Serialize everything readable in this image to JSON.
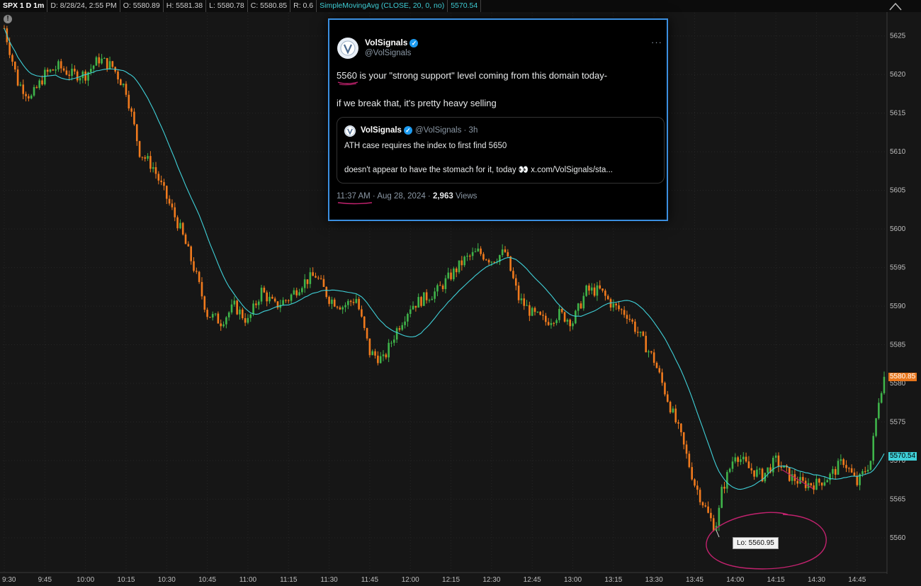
{
  "header": {
    "symbol": "SPX 1 D 1m",
    "date": "D: 8/28/24, 2:55 PM",
    "open": "O: 5580.89",
    "high": "H: 5581.38",
    "low": "L: 5580.78",
    "close": "C: 5580.85",
    "range": "R: 0.6",
    "study": "SimpleMovingAvg (CLOSE, 20, 0, no)",
    "study_value": "5570.54"
  },
  "info_icon": "!",
  "price_tags": {
    "last": "5580.85",
    "sma": "5570.54"
  },
  "low_label": "Lo: 5560.95",
  "tweet": {
    "name": "VolSignals",
    "handle": "@VolSignals",
    "more": "···",
    "text_line1": "5560 is your \"strong support\" level coming from this domain today-",
    "text_line2": "if we break that, it's pretty heavy selling",
    "quote": {
      "name": "VolSignals",
      "handle": "@VolSignals · 3h",
      "line1": "ATH case requires the index to first find 5650",
      "line2": "doesn't appear to have the stomach for it, today 👀 x.com/VolSignals/sta..."
    },
    "meta_time": "11:37 AM · Aug 28, 2024 · ",
    "meta_views_num": "2,963",
    "meta_views_label": " Views"
  },
  "colors": {
    "background": "#161616",
    "up_candle": "#3fb44a",
    "down_candle": "#f07a1d",
    "sma_line": "#3fd0d8",
    "annotation": "#c2226e",
    "tweet_border": "#3b8fe0"
  },
  "chart_data": {
    "type": "candlestick",
    "symbol": "SPX",
    "interval": "1m",
    "ylim": [
      5555.5,
      5628
    ],
    "y_ticks": [
      5625,
      5620,
      5615,
      5610,
      5605,
      5600,
      5595,
      5590,
      5585,
      5580,
      5575,
      5570,
      5565,
      5560
    ],
    "x_ticks": [
      "9:30",
      "9:45",
      "10:00",
      "10:15",
      "10:30",
      "10:45",
      "11:00",
      "11:15",
      "11:30",
      "11:45",
      "12:00",
      "12:15",
      "12:30",
      "12:45",
      "13:00",
      "13:15",
      "13:30",
      "13:45",
      "14:00",
      "14:15",
      "14:30",
      "14:45"
    ],
    "x_range_minutes": [
      0,
      325
    ],
    "close_path": [
      [
        0,
        5626
      ],
      [
        5,
        5619
      ],
      [
        10,
        5617
      ],
      [
        15,
        5620
      ],
      [
        20,
        5621
      ],
      [
        25,
        5620
      ],
      [
        30,
        5620
      ],
      [
        35,
        5622
      ],
      [
        40,
        5621
      ],
      [
        45,
        5618
      ],
      [
        50,
        5610
      ],
      [
        55,
        5608
      ],
      [
        60,
        5604
      ],
      [
        65,
        5600
      ],
      [
        70,
        5595
      ],
      [
        75,
        5589
      ],
      [
        80,
        5588
      ],
      [
        85,
        5590
      ],
      [
        90,
        5588
      ],
      [
        95,
        5592
      ],
      [
        100,
        5590
      ],
      [
        105,
        5591
      ],
      [
        110,
        5593
      ],
      [
        115,
        5594
      ],
      [
        120,
        5591
      ],
      [
        125,
        5590
      ],
      [
        130,
        5591
      ],
      [
        135,
        5584
      ],
      [
        140,
        5583
      ],
      [
        145,
        5587
      ],
      [
        150,
        5590
      ],
      [
        155,
        5591
      ],
      [
        160,
        5592
      ],
      [
        165,
        5594
      ],
      [
        170,
        5596
      ],
      [
        175,
        5597
      ],
      [
        180,
        5596
      ],
      [
        185,
        5597
      ],
      [
        190,
        5591
      ],
      [
        195,
        5589
      ],
      [
        200,
        5588
      ],
      [
        205,
        5589
      ],
      [
        210,
        5588
      ],
      [
        215,
        5592
      ],
      [
        220,
        5592
      ],
      [
        225,
        5590
      ],
      [
        230,
        5589
      ],
      [
        235,
        5586
      ],
      [
        240,
        5583
      ],
      [
        245,
        5578
      ],
      [
        250,
        5573
      ],
      [
        255,
        5567
      ],
      [
        260,
        5563
      ],
      [
        263,
        5561
      ],
      [
        265,
        5566
      ],
      [
        270,
        5571
      ],
      [
        275,
        5569
      ],
      [
        280,
        5568
      ],
      [
        285,
        5570
      ],
      [
        290,
        5568
      ],
      [
        295,
        5567
      ],
      [
        300,
        5567
      ],
      [
        305,
        5568
      ],
      [
        310,
        5570
      ],
      [
        315,
        5567
      ],
      [
        320,
        5570
      ],
      [
        323,
        5578
      ],
      [
        325,
        5581
      ]
    ],
    "sma_period": 20,
    "last_close": 5580.85,
    "sma_last": 5570.54,
    "session_low": 5560.95
  }
}
